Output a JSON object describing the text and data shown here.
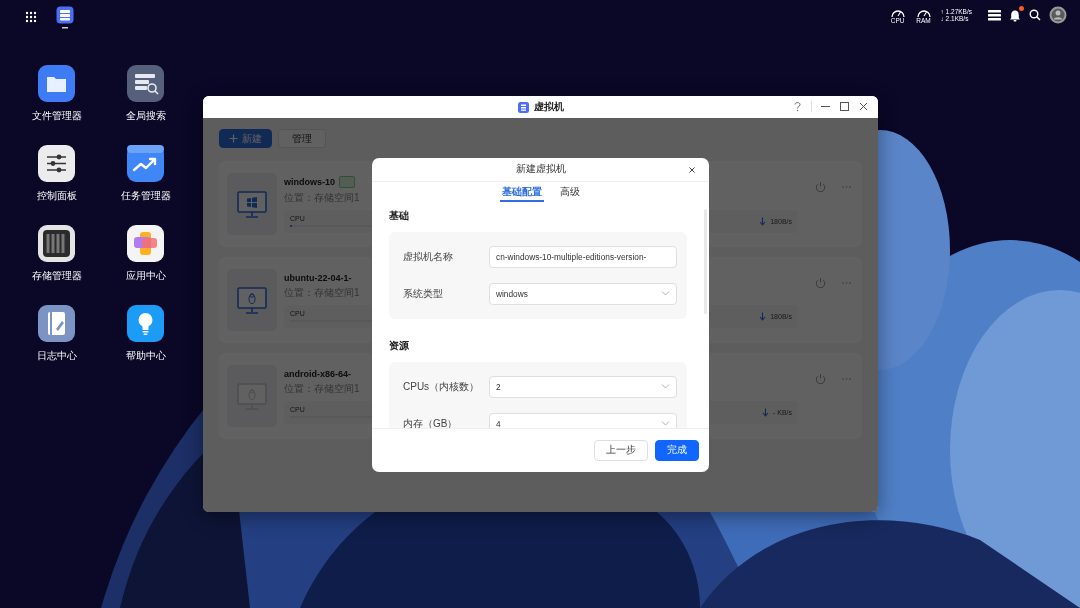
{
  "topbar": {
    "gauges": [
      {
        "label": "CPU"
      },
      {
        "label": "RAM"
      }
    ],
    "net_up": "↑ 1.27KB/s",
    "net_down": "↓ 2.1KB/s",
    "notifications": {
      "unread": true
    }
  },
  "desktop_icons": [
    {
      "label": "文件管理器",
      "kind": "files"
    },
    {
      "label": "全局搜索",
      "kind": "search"
    },
    {
      "label": "控制面板",
      "kind": "control"
    },
    {
      "label": "任务管理器",
      "kind": "tasks"
    },
    {
      "label": "存储管理器",
      "kind": "storage"
    },
    {
      "label": "应用中心",
      "kind": "apps"
    },
    {
      "label": "日志中心",
      "kind": "logs"
    },
    {
      "label": "帮助中心",
      "kind": "help"
    }
  ],
  "window": {
    "title": "虚拟机",
    "toolbar": [
      {
        "label": "新建",
        "kind": "primary"
      },
      {
        "label": "管理",
        "kind": "default"
      }
    ],
    "vms": [
      {
        "name": "windows-10",
        "kind": "windows",
        "badge": true,
        "running": true,
        "location": "位置：存储空间1",
        "cpu_label": "CPU",
        "cpu": {
          "level": 0.02
        },
        "rate": "180B/s"
      },
      {
        "name": "ubuntu-22-04-1-",
        "kind": "linux",
        "badge": false,
        "running": true,
        "location": "位置：存储空间1",
        "cpu_label": "CPU",
        "rate": "180B/s"
      },
      {
        "name": "android-x86-64-",
        "kind": "linux",
        "badge": false,
        "running": false,
        "location": "位置：存储空间1",
        "cpu_label": "CPU",
        "rate": "- KB/s"
      }
    ]
  },
  "dialog": {
    "title": "新建虚拟机",
    "tabs": [
      {
        "label": "基础配置",
        "selected": true
      },
      {
        "label": "高级",
        "selected": false
      }
    ],
    "sections": [
      {
        "title": "基础",
        "fields": [
          {
            "label": "虚拟机名称",
            "kind": "input",
            "value": "cn-windows-10-multiple-editions-version-"
          },
          {
            "label": "系统类型",
            "kind": "select",
            "value": "windows"
          }
        ]
      },
      {
        "title": "资源",
        "fields": [
          {
            "label": "CPUs（内核数）",
            "kind": "select",
            "value": "2"
          },
          {
            "label": "内存（GB）",
            "kind": "select",
            "value": "4"
          }
        ]
      }
    ],
    "buttons": [
      {
        "label": "上一步",
        "kind": "default"
      },
      {
        "label": "完成",
        "kind": "primary"
      }
    ]
  }
}
